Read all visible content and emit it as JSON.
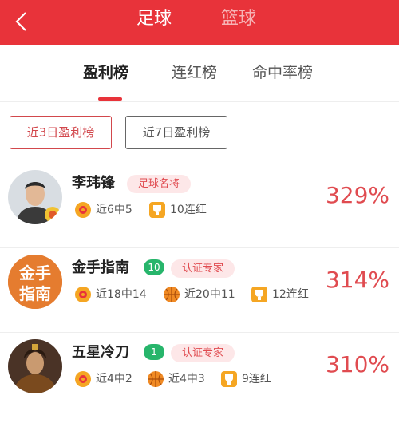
{
  "header": {
    "sport_tabs": [
      "足球",
      "篮球"
    ]
  },
  "rank_tabs": [
    "盈利榜",
    "连红榜",
    "命中率榜"
  ],
  "filters": [
    "近3日盈利榜",
    "近7日盈利榜"
  ],
  "experts": [
    {
      "name": "李玮锋",
      "title": "足球名将",
      "stats": [
        "近6中5",
        "10连红"
      ],
      "profit": "329%"
    },
    {
      "name": "金手指南",
      "level": "10",
      "title": "认证专家",
      "stats": [
        "近18中14",
        "近20中11",
        "12连红"
      ],
      "profit": "314%",
      "avatar_text": "金手指南"
    },
    {
      "name": "五星冷刀",
      "level": "1",
      "title": "认证专家",
      "stats": [
        "近4中2",
        "近4中3",
        "9连红"
      ],
      "profit": "310%"
    }
  ],
  "colors": {
    "brand_red": "#e8333a",
    "badge_green": "#27b56b",
    "text_red": "#e04b50"
  }
}
